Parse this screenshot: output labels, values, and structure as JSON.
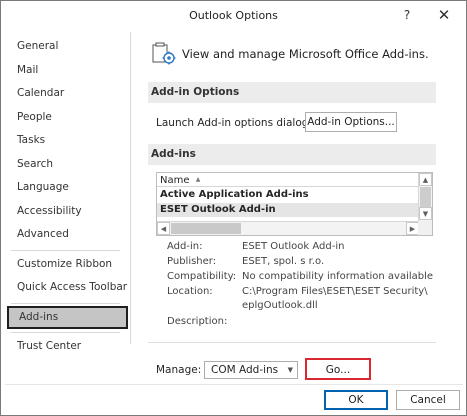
{
  "window": {
    "title": "Outlook Options",
    "help_glyph": "?",
    "close_glyph": "✕"
  },
  "sidebar": {
    "items": [
      {
        "label": "General"
      },
      {
        "label": "Mail"
      },
      {
        "label": "Calendar"
      },
      {
        "label": "People"
      },
      {
        "label": "Tasks"
      },
      {
        "label": "Search"
      },
      {
        "label": "Language"
      },
      {
        "label": "Accessibility"
      },
      {
        "label": "Advanced"
      },
      {
        "label": "Customize Ribbon"
      },
      {
        "label": "Quick Access Toolbar"
      },
      {
        "label": "Add-ins"
      },
      {
        "label": "Trust Center"
      }
    ],
    "active": "Add-ins"
  },
  "main": {
    "header_text": "View and manage Microsoft Office Add-ins.",
    "addin_options_heading": "Add-in Options",
    "launch_label": "Launch Add-in options dialog:",
    "addin_options_button": "Add-in Options...",
    "addins_heading": "Add-ins",
    "list": {
      "column_header": "Name",
      "sort_glyph": "▲",
      "rows": [
        "Active Application Add-ins",
        "ESET Outlook Add-in"
      ]
    },
    "details": {
      "addin_label": "Add-in:",
      "addin_value": "ESET Outlook Add-in",
      "publisher_label": "Publisher:",
      "publisher_value": "ESET, spol. s r.o.",
      "compat_label": "Compatibility:",
      "compat_value": "No compatibility information available",
      "location_label": "Location:",
      "location_value_1": "C:\\Program Files\\ESET\\ESET Security\\",
      "location_value_2": "eplgOutlook.dll",
      "description_label": "Description:"
    },
    "manage_label": "Manage:",
    "manage_selected": "COM Add-ins",
    "go_button": "Go..."
  },
  "footer": {
    "ok_button": "OK",
    "cancel_button": "Cancel"
  },
  "colors": {
    "highlight_red": "#d9282f",
    "ok_border": "#0063b1",
    "active_item_bg": "#c5c5c5"
  }
}
